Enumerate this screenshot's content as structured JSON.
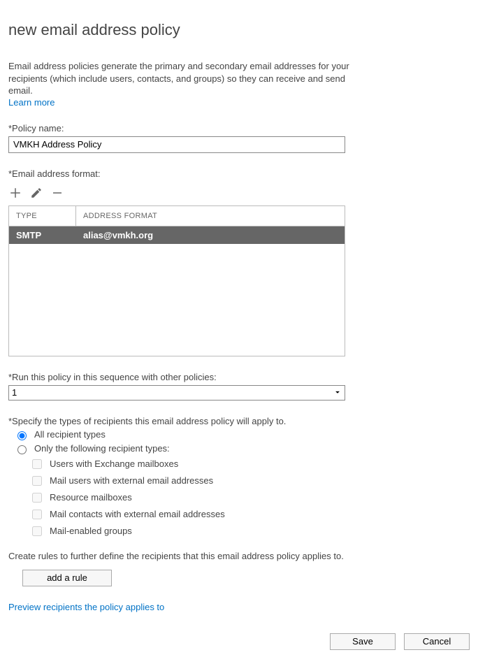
{
  "title": "new email address policy",
  "intro": "Email address policies generate the primary and secondary email addresses for your recipients (which include users, contacts, and groups) so they can receive and send email.",
  "learn_more": "Learn more",
  "policy_name_label": "*Policy name:",
  "policy_name_value": "VMKH Address Policy",
  "email_format_label": "*Email address format:",
  "grid": {
    "col_type": "TYPE",
    "col_format": "ADDRESS FORMAT",
    "rows": [
      {
        "type": "SMTP",
        "format": "alias@vmkh.org"
      }
    ]
  },
  "sequence_label": "*Run this policy in this sequence with other policies:",
  "sequence_value": "1",
  "recipients_label": "*Specify the types of recipients this email address policy will apply to.",
  "radio_all": "All recipient types",
  "radio_only": "Only the following recipient types:",
  "checks": {
    "c1": "Users with Exchange mailboxes",
    "c2": "Mail users with external email addresses",
    "c3": "Resource mailboxes",
    "c4": "Mail contacts with external email addresses",
    "c5": "Mail-enabled groups"
  },
  "rules_label": "Create rules to further define the recipients that this email address policy applies to.",
  "add_rule": "add a rule",
  "preview_link": "Preview recipients the policy applies to",
  "buttons": {
    "save": "Save",
    "cancel": "Cancel"
  }
}
